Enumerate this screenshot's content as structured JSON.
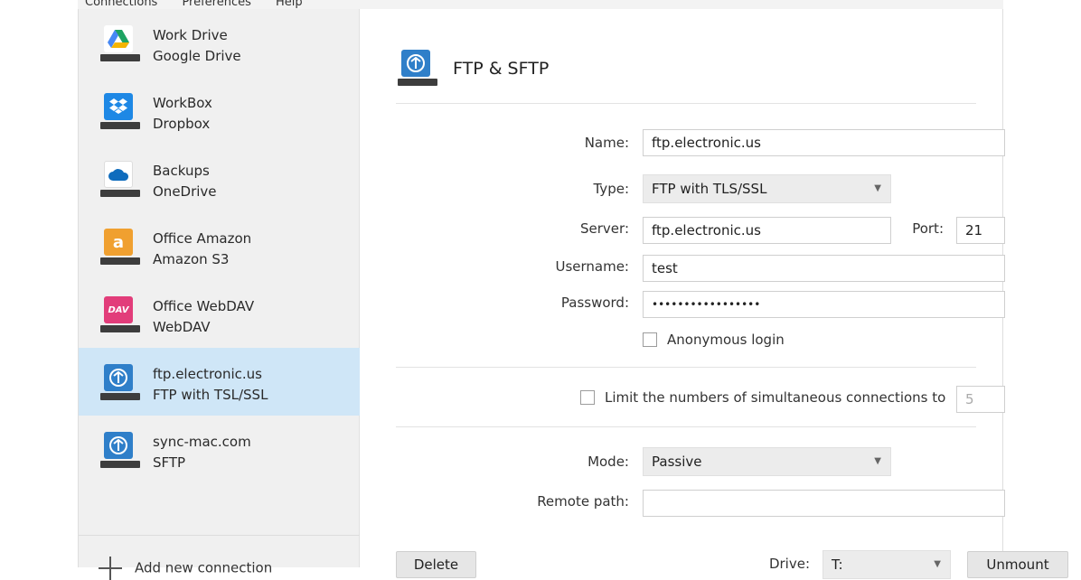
{
  "menubar": {
    "items": [
      "Connections",
      "Preferences",
      "Help"
    ]
  },
  "sidebar": {
    "items": [
      {
        "name": "Work Drive",
        "type": "Google Drive",
        "icon": "google-drive-icon"
      },
      {
        "name": "WorkBox",
        "type": "Dropbox",
        "icon": "dropbox-icon"
      },
      {
        "name": "Backups",
        "type": "OneDrive",
        "icon": "onedrive-icon"
      },
      {
        "name": "Office Amazon",
        "type": "Amazon S3",
        "icon": "amazon-s3-icon"
      },
      {
        "name": "Office WebDAV",
        "type": "WebDAV",
        "icon": "webdav-icon",
        "badge": "DAV"
      },
      {
        "name": "ftp.electronic.us",
        "type": "FTP with TSL/SSL",
        "icon": "ftp-icon",
        "selected": true
      },
      {
        "name": "sync-mac.com",
        "type": "SFTP",
        "icon": "sftp-icon"
      }
    ],
    "add_label": "Add new connection"
  },
  "header": {
    "title": "FTP & SFTP",
    "icon": "ftp-icon"
  },
  "form": {
    "name_label": "Name:",
    "name_value": "ftp.electronic.us",
    "type_label": "Type:",
    "type_value": "FTP with TLS/SSL",
    "server_label": "Server:",
    "server_value": "ftp.electronic.us",
    "port_label": "Port:",
    "port_value": "21",
    "username_label": "Username:",
    "username_value": "test",
    "password_label": "Password:",
    "password_value": "•••••••••••••••••",
    "anonymous_label": "Anonymous login",
    "limit_label": "Limit the numbers of simultaneous connections to",
    "limit_value": "5",
    "mode_label": "Mode:",
    "mode_value": "Passive",
    "remote_label": "Remote path:",
    "remote_value": ""
  },
  "footer": {
    "delete_label": "Delete",
    "drive_label": "Drive:",
    "drive_value": "T:",
    "unmount_label": "Unmount"
  },
  "colors": {
    "selected_bg": "#cfe6f7",
    "sidebar_bg": "#f0f0f0",
    "ftp_blue": "#2f7fc9",
    "amazon": "#f0a030",
    "webdav": "#e23d7a"
  }
}
